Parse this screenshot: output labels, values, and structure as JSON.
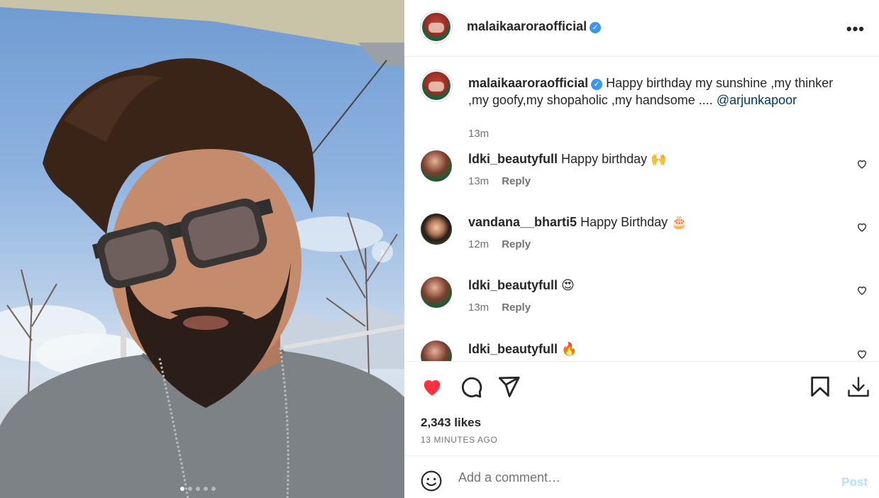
{
  "post": {
    "author": "malaikaaroraofficial",
    "verified_symbol": "✓",
    "more_icon": "•••",
    "caption_text": "Happy birthday my sunshine ,my thinker ,my goofy,my shopaholic ,my handsome .... ",
    "caption_mention": "@arjunkapoor",
    "caption_time": "13m",
    "likes": "2,343 likes",
    "posted_ago": "13 MINUTES AGO",
    "liked": true,
    "like_color": "#ff3040"
  },
  "carousel": {
    "next_glyph": "›",
    "slide_count": 5,
    "active_slide": 1
  },
  "comments": [
    {
      "user": "ldki_beautyfull",
      "text": "Happy birthday ",
      "emoji": "🙌",
      "time": "13m",
      "reply": "Reply"
    },
    {
      "user": "vandana__bharti5",
      "text": "Happy Birthday ",
      "emoji": "🎂",
      "time": "12m",
      "reply": "Reply"
    },
    {
      "user": "ldki_beautyfull",
      "text": "",
      "emoji": "😍",
      "time": "13m",
      "reply": "Reply"
    },
    {
      "user": "ldki_beautyfull",
      "text": "",
      "emoji": "🔥",
      "time": "",
      "reply": ""
    }
  ],
  "composer": {
    "placeholder": "Add a comment…",
    "post_label": "Post"
  },
  "icons": {
    "like": "heart-icon",
    "comment": "comment-bubble-icon",
    "share": "paper-plane-icon",
    "save": "bookmark-icon",
    "download": "download-icon",
    "emoji": "smiley-icon"
  }
}
